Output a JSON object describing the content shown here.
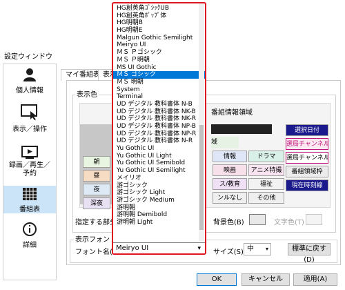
{
  "window": {
    "title": "設定ウィンドウ"
  },
  "sidebar": {
    "items": [
      {
        "label": "個人情報",
        "icon": "person-icon"
      },
      {
        "label": "表示／操作",
        "icon": "touch-screen-icon"
      },
      {
        "label": "録画／再生／予約",
        "icon": "play-screen-icon"
      },
      {
        "label": "番組表",
        "icon": "grid-table-icon"
      },
      {
        "label": "詳細",
        "icon": "info-icon"
      }
    ],
    "selected_index": 3
  },
  "tabs": [
    "マイ番組表",
    "表示"
  ],
  "display_color": {
    "group_label": "表示色",
    "header_label": "番組情報領域",
    "row_labels": [
      "朝",
      "昼",
      "夜",
      "深夜"
    ],
    "genre_cells": [
      "情報",
      "ドラマ",
      "映画",
      "アニメ特撮",
      "ス/教育",
      "福祉",
      "ンルなし",
      "その他"
    ],
    "right_cells": [
      "選択日付",
      "選局チャンネル",
      "選局チャンネル枠",
      "番組領域枠",
      "現在時刻線"
    ],
    "partial_cell": "域",
    "apply_label": "指定する部分",
    "bg_color_label": "背景色(B)",
    "text_color_label": "文字色(T)"
  },
  "display_font": {
    "group_label": "表示フォント",
    "font_name_label": "フォント名(F)",
    "font_name_value": "Meiryo UI",
    "size_label": "サイズ(S)",
    "size_value": "中",
    "reset_button": "標準に戻す(D)"
  },
  "font_dropdown": {
    "items": [
      "HG創英角ｺﾞｼｯｸUB",
      "HG創英角ﾎﾟｯﾌﾟ体",
      "HG明朝B",
      "HG明朝E",
      "Malgun Gothic Semilight",
      "Meiryo UI",
      "ＭＳ Ｐゴシック",
      "ＭＳ Ｐ明朝",
      "MS UI Gothic",
      "ＭＳ ゴシック",
      "ＭＳ 明朝",
      "System",
      "Terminal",
      "UD デジタル 教科書体 N-B",
      "UD デジタル 教科書体 NK-B",
      "UD デジタル 教科書体 NK-R",
      "UD デジタル 教科書体 NP-B",
      "UD デジタル 教科書体 NP-R",
      "UD デジタル 教科書体 N-R",
      "Yu Gothic UI",
      "Yu Gothic UI Light",
      "Yu Gothic UI Semibold",
      "Yu Gothic UI Semilight",
      "メイリオ",
      "游ゴシック",
      "游ゴシック Light",
      "游ゴシック Medium",
      "游明朝",
      "游明朝 Demibold",
      "游明朝 Light"
    ],
    "selected_index": 9,
    "field_value": "Meiryo UI"
  },
  "footer": {
    "ok": "OK",
    "cancel": "キャンセル",
    "apply": "適用(A)"
  },
  "colors": {
    "accent": "#0078d7",
    "highlight_border": "#e0141e",
    "navy": "#1a1a8c",
    "magenta": "#c0157a",
    "morning": "#e8f5e0",
    "noon": "#f7dcc4",
    "night": "#dde9f5",
    "late_night": "#e8e0f3"
  }
}
